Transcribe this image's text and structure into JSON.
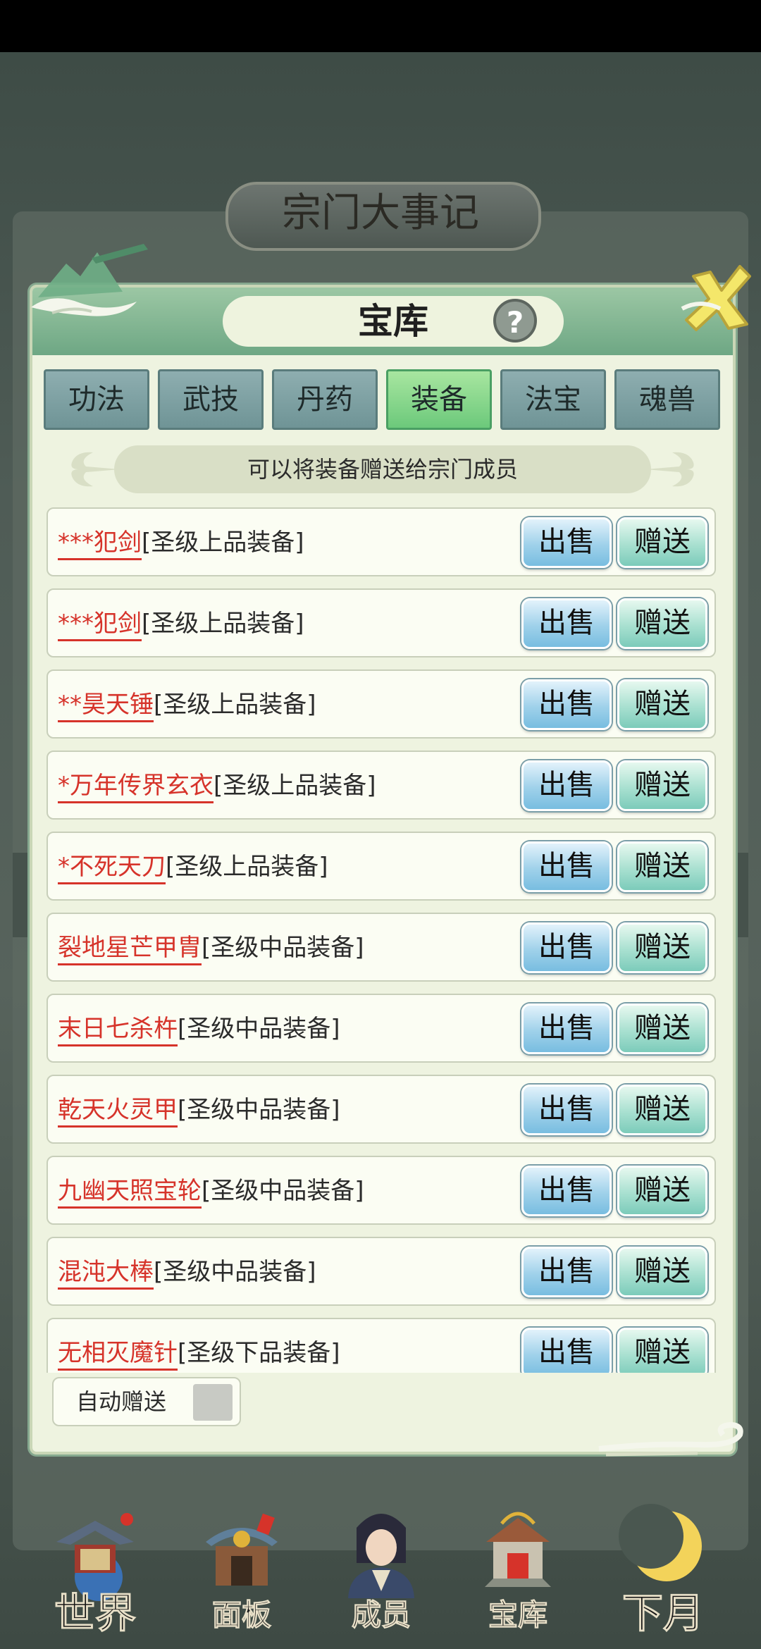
{
  "background": {
    "title": "宗门大事记"
  },
  "dialog": {
    "title": "宝库",
    "help_symbol": "?",
    "tabs": [
      {
        "label": "功法",
        "active": false
      },
      {
        "label": "武技",
        "active": false
      },
      {
        "label": "丹药",
        "active": false
      },
      {
        "label": "装备",
        "active": true
      },
      {
        "label": "法宝",
        "active": false
      },
      {
        "label": "魂兽",
        "active": false
      }
    ],
    "hint": "可以将装备赠送给宗门成员",
    "items": [
      {
        "name": "***犯剑",
        "grade": "[圣级上品装备]"
      },
      {
        "name": "***犯剑",
        "grade": "[圣级上品装备]"
      },
      {
        "name": "**昊天锤",
        "grade": "[圣级上品装备]"
      },
      {
        "name": "*万年传界玄衣",
        "grade": "[圣级上品装备]"
      },
      {
        "name": "*不死天刀",
        "grade": "[圣级上品装备]"
      },
      {
        "name": "裂地星芒甲胄",
        "grade": "[圣级中品装备]"
      },
      {
        "name": "末日七杀杵",
        "grade": "[圣级中品装备]"
      },
      {
        "name": "乾天火灵甲",
        "grade": "[圣级中品装备]"
      },
      {
        "name": "九幽天照宝轮",
        "grade": "[圣级中品装备]"
      },
      {
        "name": "混沌大棒",
        "grade": "[圣级中品装备]"
      },
      {
        "name": "无相灭魔针",
        "grade": "[圣级下品装备]"
      }
    ],
    "sell_label": "出售",
    "gift_label": "赠送",
    "auto_gift_label": "自动赠送",
    "auto_gift_checked": false
  },
  "nav": [
    {
      "label": "世界",
      "icon": "world-pavilion-icon"
    },
    {
      "label": "面板",
      "icon": "panel-gate-icon"
    },
    {
      "label": "成员",
      "icon": "member-portrait-icon"
    },
    {
      "label": "宝库",
      "icon": "treasury-building-icon"
    },
    {
      "label": "下月",
      "icon": "crescent-moon-icon"
    }
  ],
  "colors": {
    "item_name": "#d6332a",
    "tab_active": "#6cc97b",
    "tab_inactive": "#7fa3a5",
    "header_green": "#86b894"
  }
}
